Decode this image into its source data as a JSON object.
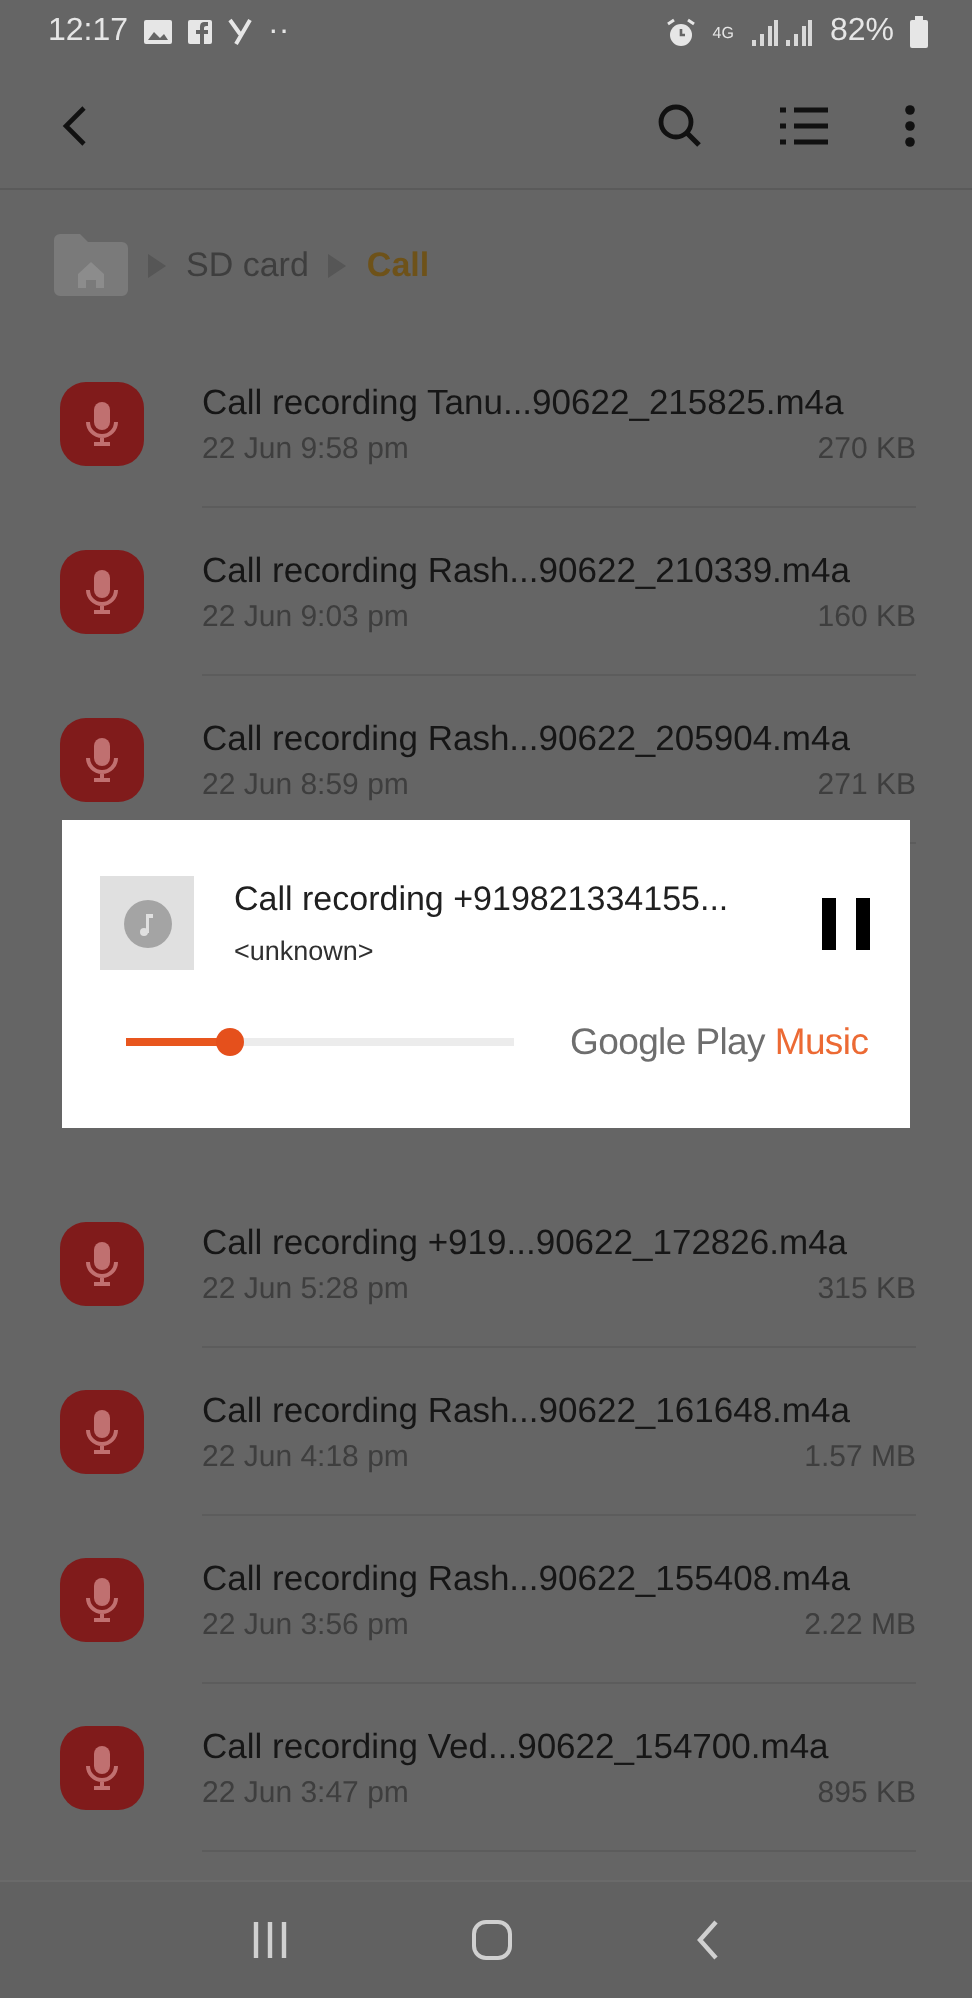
{
  "status_bar": {
    "time": "12:17",
    "overflow": "··",
    "network": "4G",
    "battery": "82%"
  },
  "breadcrumb": [
    {
      "label": "SD card",
      "selected": false
    },
    {
      "label": "Call",
      "selected": true
    }
  ],
  "files_before": [
    {
      "name": "Call recording Tanu...90622_215825.m4a",
      "date": "22 Jun 9:58 pm",
      "size": "270 KB"
    },
    {
      "name": "Call recording Rash...90622_210339.m4a",
      "date": "22 Jun 9:03 pm",
      "size": "160 KB"
    },
    {
      "name": "Call recording Rash...90622_205904.m4a",
      "date": "22 Jun 8:59 pm",
      "size": "271 KB"
    }
  ],
  "player": {
    "title": "Call recording +919821334155...",
    "artist": "<unknown>",
    "level": 0.27,
    "brand": "Google Play",
    "brand_accent": "Music"
  },
  "files_after": [
    {
      "name": "Call recording +919...90622_172826.m4a",
      "date": "22 Jun 5:28 pm",
      "size": "315 KB"
    },
    {
      "name": "Call recording Rash...90622_161648.m4a",
      "date": "22 Jun 4:18 pm",
      "size": "1.57 MB"
    },
    {
      "name": "Call recording Rash...90622_155408.m4a",
      "date": "22 Jun 3:56 pm",
      "size": "2.22 MB"
    },
    {
      "name": "Call recording Ved...90622_154700.m4a",
      "date": "22 Jun 3:47 pm",
      "size": "895 KB"
    }
  ]
}
